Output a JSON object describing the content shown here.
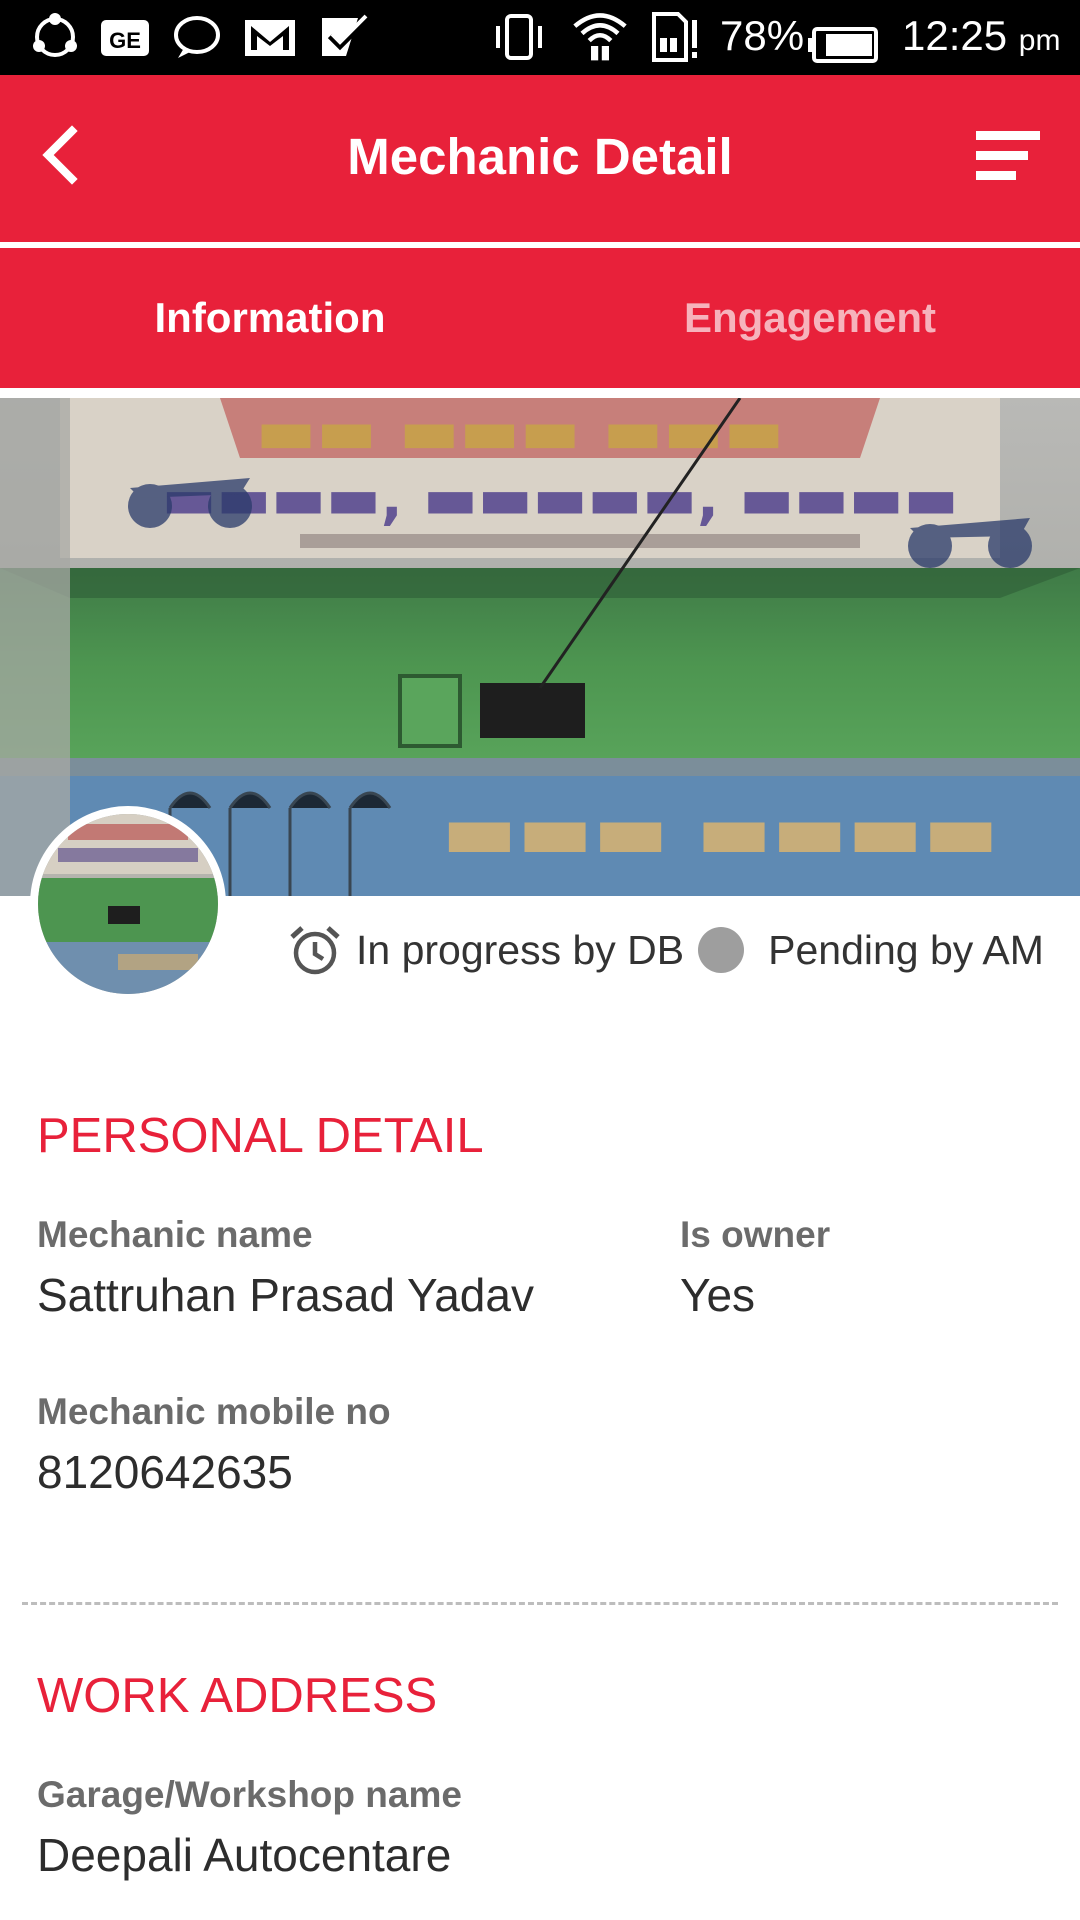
{
  "status_bar": {
    "battery": "78%",
    "time": "12:25",
    "ampm": "pm"
  },
  "toolbar": {
    "title": "Mechanic Detail",
    "back_icon": "chevron-left-icon",
    "menu_icon": "filter-menu-icon"
  },
  "tabs": [
    {
      "label": "Information",
      "active": true
    },
    {
      "label": "Engagement",
      "active": false
    }
  ],
  "status": {
    "progress_text": "In progress by DB",
    "pending_text": "Pending by AM"
  },
  "personal_detail": {
    "heading": "PERSONAL DETAIL",
    "mechanic_name_label": "Mechanic name",
    "mechanic_name": "Sattruhan Prasad Yadav",
    "is_owner_label": "Is owner",
    "is_owner": "Yes",
    "mobile_label": "Mechanic mobile no",
    "mobile": "8120642635"
  },
  "work_address": {
    "heading": "WORK ADDRESS",
    "garage_label": "Garage/Workshop name",
    "garage_name": "Deepali Autocentare"
  },
  "colors": {
    "brand": "#e8213a",
    "status_dot": "#9e9e9e"
  }
}
